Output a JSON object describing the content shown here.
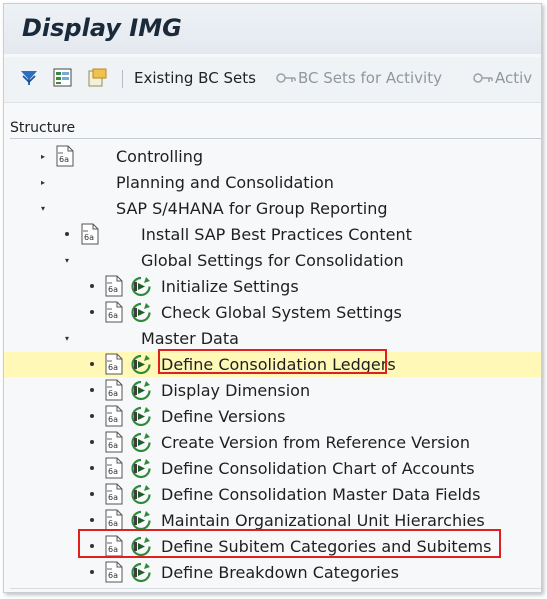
{
  "window": {
    "title": "Display IMG"
  },
  "toolbar": {
    "existing_bc_sets": "Existing BC Sets",
    "bc_sets_for_activity": "BC Sets for Activity",
    "bc_sets_truncated": "Activ"
  },
  "structure": {
    "header": "Structure"
  },
  "tree": {
    "controlling": "Controlling",
    "planning": "Planning and Consolidation",
    "group_reporting": "SAP S/4HANA for Group Reporting",
    "install_best_practices": "Install SAP Best Practices Content",
    "global_settings": "Global Settings for Consolidation",
    "initialize_settings": "Initialize Settings",
    "check_global_settings": "Check Global System Settings",
    "master_data": "Master Data",
    "define_consolidation_ledgers": "Define Consolidation Ledgers",
    "display_dimension": "Display Dimension",
    "define_versions": "Define Versions",
    "create_version": "Create Version from Reference Version",
    "define_chart_of_accounts": "Define Consolidation Chart of Accounts",
    "define_master_data_fields": "Define Consolidation Master Data Fields",
    "maintain_org_hierarchies": "Maintain Organizational Unit Hierarchies",
    "define_subitem_categories": "Define Subitem Categories and Subitems",
    "define_breakdown_categories": "Define Breakdown Categories"
  },
  "colors": {
    "highlight_row": "#fff8b6",
    "annotation_red": "#e01f1f",
    "toolbar_blue": "#2a6fc4",
    "exec_green": "#2e8b3a"
  }
}
